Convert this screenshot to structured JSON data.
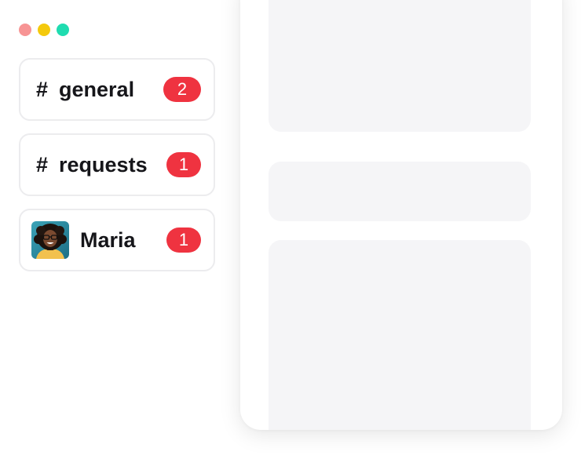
{
  "window_controls": {
    "close_color": "#f79494",
    "minimize_color": "#f4c90c",
    "maximize_color": "#1fdcb0"
  },
  "channels": [
    {
      "prefix": "#",
      "name": "general",
      "unread": "2",
      "icon": "hash-icon"
    },
    {
      "prefix": "#",
      "name": "requests",
      "unread": "1",
      "icon": "hash-icon"
    }
  ],
  "direct_messages": [
    {
      "name": "Maria",
      "unread": "1",
      "icon": "user-avatar"
    }
  ],
  "colors": {
    "badge": "#ef3340",
    "text": "#16161a",
    "border": "#ececee",
    "skeleton": "#f5f5f7"
  },
  "content_panel": {
    "state": "loading-skeleton",
    "placeholder_blocks": 3
  }
}
